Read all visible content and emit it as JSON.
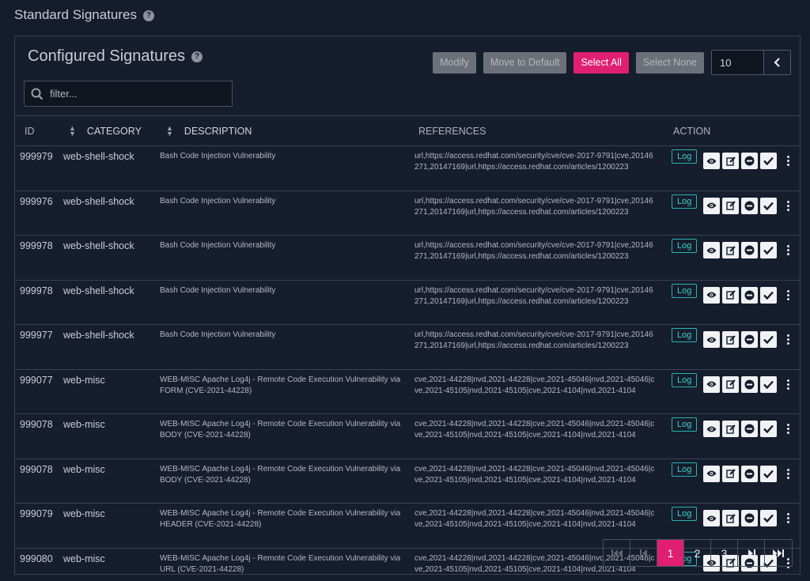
{
  "page": {
    "title": "Standard Signatures",
    "help": "?"
  },
  "panel": {
    "title": "Configured Signatures",
    "help": "?"
  },
  "toolbar": {
    "modify": "Modify",
    "move_default": "Move to Default",
    "select_all": "Select All",
    "select_none": "Select None",
    "page_size": "10"
  },
  "filter": {
    "placeholder": "filter..."
  },
  "columns": {
    "id": "ID",
    "category": "CATEGORY",
    "description": "DESCRIPTION",
    "references": "REFERENCES",
    "action": "ACTION"
  },
  "rows": [
    {
      "id": "999979",
      "category": "web-shell-shock",
      "description": "Bash Code Injection Vulnerability",
      "references": "url,https://access.redhat.com/security/cve/cve-2017-9791|cve,20146271,20147169|url,https://access.redhat.com/articles/1200223",
      "log": "Log"
    },
    {
      "id": "999976",
      "category": "web-shell-shock",
      "description": "Bash Code Injection Vulnerability",
      "references": "url,https://access.redhat.com/security/cve/cve-2017-9791|cve,20146271,20147169|url,https://access.redhat.com/articles/1200223",
      "log": "Log"
    },
    {
      "id": "999978",
      "category": "web-shell-shock",
      "description": "Bash Code Injection Vulnerability",
      "references": "url,https://access.redhat.com/security/cve/cve-2017-9791|cve,20146271,20147169|url,https://access.redhat.com/articles/1200223",
      "log": "Log"
    },
    {
      "id": "999978",
      "category": "web-shell-shock",
      "description": "Bash Code Injection Vulnerability",
      "references": "url,https://access.redhat.com/security/cve/cve-2017-9791|cve,20146271,20147169|url,https://access.redhat.com/articles/1200223",
      "log": "Log"
    },
    {
      "id": "999977",
      "category": "web-shell-shock",
      "description": "Bash Code Injection Vulnerability",
      "references": "url,https://access.redhat.com/security/cve/cve-2017-9791|cve,20146271,20147169|url,https://access.redhat.com/articles/1200223",
      "log": "Log"
    },
    {
      "id": "999077",
      "category": "web-misc",
      "description": "WEB-MISC Apache Log4j - Remote Code Execution Vulnerability via FORM (CVE-2021-44228)",
      "references": "cve,2021-44228|nvd,2021-44228|cve,2021-45046|nvd,2021-45046|cve,2021-45105|nvd,2021-45105|cve,2021-4104|nvd,2021-4104",
      "log": "Log"
    },
    {
      "id": "999078",
      "category": "web-misc",
      "description": "WEB-MISC Apache Log4j - Remote Code Execution Vulnerability via BODY (CVE-2021-44228)",
      "references": "cve,2021-44228|nvd,2021-44228|cve,2021-45046|nvd,2021-45046|cve,2021-45105|nvd,2021-45105|cve,2021-4104|nvd,2021-4104",
      "log": "Log"
    },
    {
      "id": "999078",
      "category": "web-misc",
      "description": "WEB-MISC Apache Log4j - Remote Code Execution Vulnerability via BODY (CVE-2021-44228)",
      "references": "cve,2021-44228|nvd,2021-44228|cve,2021-45046|nvd,2021-45046|cve,2021-45105|nvd,2021-45105|cve,2021-4104|nvd,2021-4104",
      "log": "Log"
    },
    {
      "id": "999079",
      "category": "web-misc",
      "description": "WEB-MISC Apache Log4j - Remote Code Execution Vulnerability via HEADER (CVE-2021-44228)",
      "references": "cve,2021-44228|nvd,2021-44228|cve,2021-45046|nvd,2021-45046|cve,2021-45105|nvd,2021-45105|cve,2021-4104|nvd,2021-4104",
      "log": "Log"
    },
    {
      "id": "999080",
      "category": "web-misc",
      "description": "WEB-MISC Apache Log4j - Remote Code Execution Vulnerability via URL (CVE-2021-44228)",
      "references": "cve,2021-44228|nvd,2021-44228|cve,2021-45046|nvd,2021-45046|cve,2021-45105|nvd,2021-45105|cve,2021-4104|nvd,2021-4104",
      "log": "Log"
    }
  ],
  "row_icons": [
    "eye-icon",
    "edit-icon",
    "disable-icon",
    "check-icon",
    "kebab-icon"
  ],
  "pagination": {
    "pages": [
      "1",
      "2",
      "3"
    ],
    "active": "1"
  },
  "colors": {
    "accent": "#e01f72",
    "log": "#27b3b3",
    "background": "#151c2c"
  }
}
